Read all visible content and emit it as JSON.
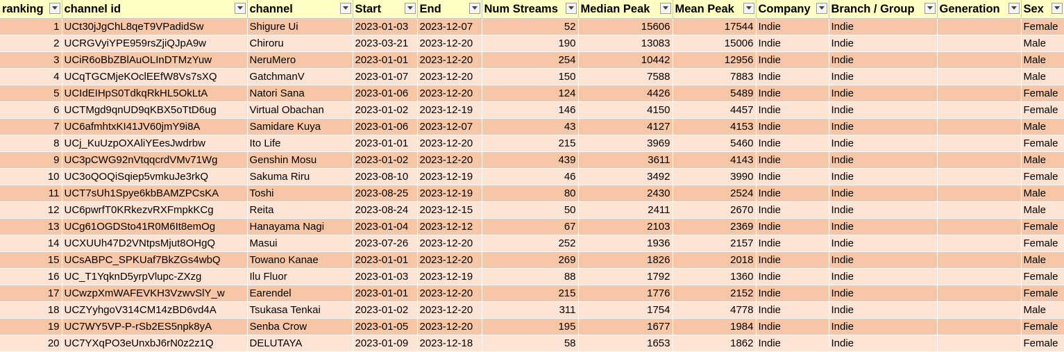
{
  "headers": [
    "ranking",
    "channel id",
    "channel",
    "Start",
    "End",
    "Num Streams",
    "Median Peak",
    "Mean Peak",
    "Company",
    "Branch / Group",
    "Generation",
    "Sex"
  ],
  "filter_icon": "dropdown-arrow-icon",
  "rows": [
    {
      "ranking": "1",
      "channel_id": "UCt30jJgChL8qeT9VPadidSw",
      "channel": "Shigure Ui",
      "start": "2023-01-03",
      "end": "2023-12-07",
      "num_streams": "52",
      "median_peak": "15606",
      "mean_peak": "17544",
      "company": "Indie",
      "branch": "Indie",
      "generation": "",
      "sex": "Female"
    },
    {
      "ranking": "2",
      "channel_id": "UCRGVyiYPE959rsZjiQJpA9w",
      "channel": "Chiroru",
      "start": "2023-03-21",
      "end": "2023-12-20",
      "num_streams": "190",
      "median_peak": "13083",
      "mean_peak": "15006",
      "company": "Indie",
      "branch": "Indie",
      "generation": "",
      "sex": "Male"
    },
    {
      "ranking": "3",
      "channel_id": "UCiR6oBbZBlAuOLInDTMzYuw",
      "channel": "NeruMero",
      "start": "2023-01-01",
      "end": "2023-12-20",
      "num_streams": "254",
      "median_peak": "10442",
      "mean_peak": "12956",
      "company": "Indie",
      "branch": "Indie",
      "generation": "",
      "sex": "Male"
    },
    {
      "ranking": "4",
      "channel_id": "UCqTGCMjeKOclEEfW8Vs7sXQ",
      "channel": "GatchmanV",
      "start": "2023-01-07",
      "end": "2023-12-20",
      "num_streams": "150",
      "median_peak": "7588",
      "mean_peak": "7883",
      "company": "Indie",
      "branch": "Indie",
      "generation": "",
      "sex": "Male"
    },
    {
      "ranking": "5",
      "channel_id": "UCIdEIHpS0TdkqRkHL5OkLtA",
      "channel": "Natori Sana",
      "start": "2023-01-06",
      "end": "2023-12-20",
      "num_streams": "124",
      "median_peak": "4426",
      "mean_peak": "5489",
      "company": "Indie",
      "branch": "Indie",
      "generation": "",
      "sex": "Female"
    },
    {
      "ranking": "6",
      "channel_id": "UCTMgd9qnUD9qKBX5oTtD6ug",
      "channel": "Virtual Obachan",
      "start": "2023-01-02",
      "end": "2023-12-19",
      "num_streams": "146",
      "median_peak": "4150",
      "mean_peak": "4457",
      "company": "Indie",
      "branch": "Indie",
      "generation": "",
      "sex": "Female"
    },
    {
      "ranking": "7",
      "channel_id": "UC6afmhtxKI41JV60jmY9i8A",
      "channel": "Samidare Kuya",
      "start": "2023-01-06",
      "end": "2023-12-07",
      "num_streams": "43",
      "median_peak": "4127",
      "mean_peak": "4153",
      "company": "Indie",
      "branch": "Indie",
      "generation": "",
      "sex": "Male"
    },
    {
      "ranking": "8",
      "channel_id": "UCj_KuUzpOXAliYEesJwdrbw",
      "channel": "Ito Life",
      "start": "2023-01-01",
      "end": "2023-12-20",
      "num_streams": "215",
      "median_peak": "3969",
      "mean_peak": "5460",
      "company": "Indie",
      "branch": "Indie",
      "generation": "",
      "sex": "Female"
    },
    {
      "ranking": "9",
      "channel_id": "UC3pCWG92nVtqqcrdVMv71Wg",
      "channel": "Genshin Mosu",
      "start": "2023-01-02",
      "end": "2023-12-20",
      "num_streams": "439",
      "median_peak": "3611",
      "mean_peak": "4143",
      "company": "Indie",
      "branch": "Indie",
      "generation": "",
      "sex": "Male"
    },
    {
      "ranking": "10",
      "channel_id": "UC3oQOQiSqiep5vmkuJe3rkQ",
      "channel": "Sakuma Riru",
      "start": "2023-08-10",
      "end": "2023-12-19",
      "num_streams": "46",
      "median_peak": "3492",
      "mean_peak": "3990",
      "company": "Indie",
      "branch": "Indie",
      "generation": "",
      "sex": "Female"
    },
    {
      "ranking": "11",
      "channel_id": "UCT7sUh1Spye6kbBAMZPCsKA",
      "channel": "Toshi",
      "start": "2023-08-25",
      "end": "2023-12-19",
      "num_streams": "80",
      "median_peak": "2430",
      "mean_peak": "2524",
      "company": "Indie",
      "branch": "Indie",
      "generation": "",
      "sex": "Male"
    },
    {
      "ranking": "12",
      "channel_id": "UC6pwrfT0KRkezvRXFmpkKCg",
      "channel": "Reita",
      "start": "2023-08-24",
      "end": "2023-12-15",
      "num_streams": "50",
      "median_peak": "2411",
      "mean_peak": "2670",
      "company": "Indie",
      "branch": "Indie",
      "generation": "",
      "sex": "Male"
    },
    {
      "ranking": "13",
      "channel_id": "UCg61OGDSto41R0M6It8emOg",
      "channel": "Hanayama Nagi",
      "start": "2023-01-04",
      "end": "2023-12-12",
      "num_streams": "67",
      "median_peak": "2103",
      "mean_peak": "2369",
      "company": "Indie",
      "branch": "Indie",
      "generation": "",
      "sex": "Female"
    },
    {
      "ranking": "14",
      "channel_id": "UCXUUh47D2VNtpsMjut8OHgQ",
      "channel": "Masui",
      "start": "2023-07-26",
      "end": "2023-12-20",
      "num_streams": "252",
      "median_peak": "1936",
      "mean_peak": "2157",
      "company": "Indie",
      "branch": "Indie",
      "generation": "",
      "sex": "Female"
    },
    {
      "ranking": "15",
      "channel_id": "UCsABPC_SPKUaf7BkZGs4wbQ",
      "channel": "Towano Kanae",
      "start": "2023-01-01",
      "end": "2023-12-20",
      "num_streams": "269",
      "median_peak": "1826",
      "mean_peak": "2018",
      "company": "Indie",
      "branch": "Indie",
      "generation": "",
      "sex": "Male"
    },
    {
      "ranking": "16",
      "channel_id": "UC_T1YqknD5yrpVlupc-ZXzg",
      "channel": "Ilu Fluor",
      "start": "2023-01-03",
      "end": "2023-12-19",
      "num_streams": "88",
      "median_peak": "1792",
      "mean_peak": "1360",
      "company": "Indie",
      "branch": "Indie",
      "generation": "",
      "sex": "Female"
    },
    {
      "ranking": "17",
      "channel_id": "UCwzpXmWAFEVKH3VzwvSlY_w",
      "channel": "Earendel",
      "start": "2023-01-01",
      "end": "2023-12-20",
      "num_streams": "215",
      "median_peak": "1776",
      "mean_peak": "2152",
      "company": "Indie",
      "branch": "Indie",
      "generation": "",
      "sex": "Female"
    },
    {
      "ranking": "18",
      "channel_id": "UCZYyhgoV314CM14zBD6vd4A",
      "channel": "Tsukasa Tenkai",
      "start": "2023-01-02",
      "end": "2023-12-20",
      "num_streams": "311",
      "median_peak": "1754",
      "mean_peak": "4778",
      "company": "Indie",
      "branch": "Indie",
      "generation": "",
      "sex": "Male"
    },
    {
      "ranking": "19",
      "channel_id": "UC7WY5VP-P-rSb2ES5npk8yA",
      "channel": "Senba Crow",
      "start": "2023-01-05",
      "end": "2023-12-20",
      "num_streams": "195",
      "median_peak": "1677",
      "mean_peak": "1984",
      "company": "Indie",
      "branch": "Indie",
      "generation": "",
      "sex": "Female"
    },
    {
      "ranking": "20",
      "channel_id": "UC7YXqPO3eUnxbJ6rN0z2z1Q",
      "channel": "DELUTAYA",
      "start": "2023-01-09",
      "end": "2023-12-18",
      "num_streams": "58",
      "median_peak": "1653",
      "mean_peak": "1862",
      "company": "Indie",
      "branch": "Indie",
      "generation": "",
      "sex": "Female"
    }
  ],
  "colors": {
    "header_bg": "#fdfdc4",
    "row_odd": "#f7c6a6",
    "row_even": "#fce3d4"
  }
}
